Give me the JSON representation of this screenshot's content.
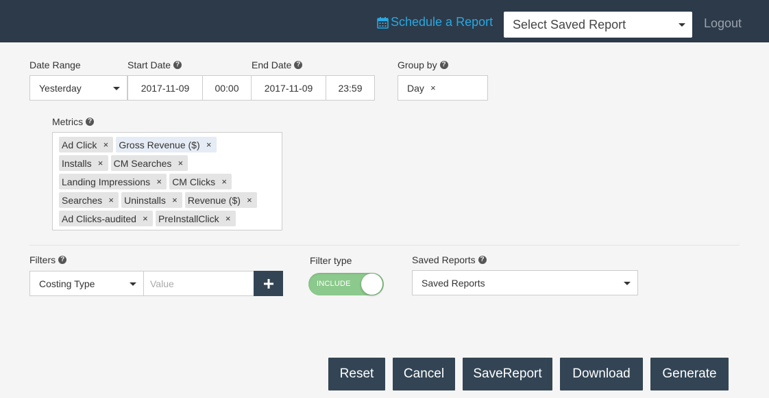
{
  "header": {
    "schedule_label": "Schedule a Report",
    "saved_report_select": "Select Saved Report",
    "logout_label": "Logout"
  },
  "date_range": {
    "label": "Date Range",
    "value": "Yesterday"
  },
  "start_date": {
    "label": "Start Date",
    "date": "2017-11-09",
    "time": "00:00"
  },
  "end_date": {
    "label": "End Date",
    "date": "2017-11-09",
    "time": "23:59"
  },
  "group_by": {
    "label": "Group by",
    "tags": [
      "Day"
    ]
  },
  "metrics": {
    "label": "Metrics",
    "rows": [
      [
        "Ad Click",
        "Gross Revenue ($)"
      ],
      [
        "Installs",
        "CM Searches"
      ],
      [
        "Landing Impressions",
        "CM Clicks"
      ],
      [
        "Searches",
        "Uninstalls",
        "Revenue ($)"
      ],
      [
        "Ad Clicks-audited",
        "PreInstallClick"
      ]
    ]
  },
  "filters": {
    "label": "Filters",
    "field": "Costing Type",
    "value_placeholder": "Value"
  },
  "filter_type": {
    "label": "Filter type",
    "toggle_label": "INCLUDE",
    "color": "#8cc98c"
  },
  "saved_reports": {
    "label": "Saved Reports",
    "value": "Saved Reports"
  },
  "actions": {
    "reset": "Reset",
    "cancel": "Cancel",
    "save": "SaveReport",
    "download": "Download",
    "generate": "Generate"
  },
  "colors": {
    "header_bg": "#2c3a4a",
    "accent": "#29a8e0",
    "button_bg": "#334555"
  }
}
